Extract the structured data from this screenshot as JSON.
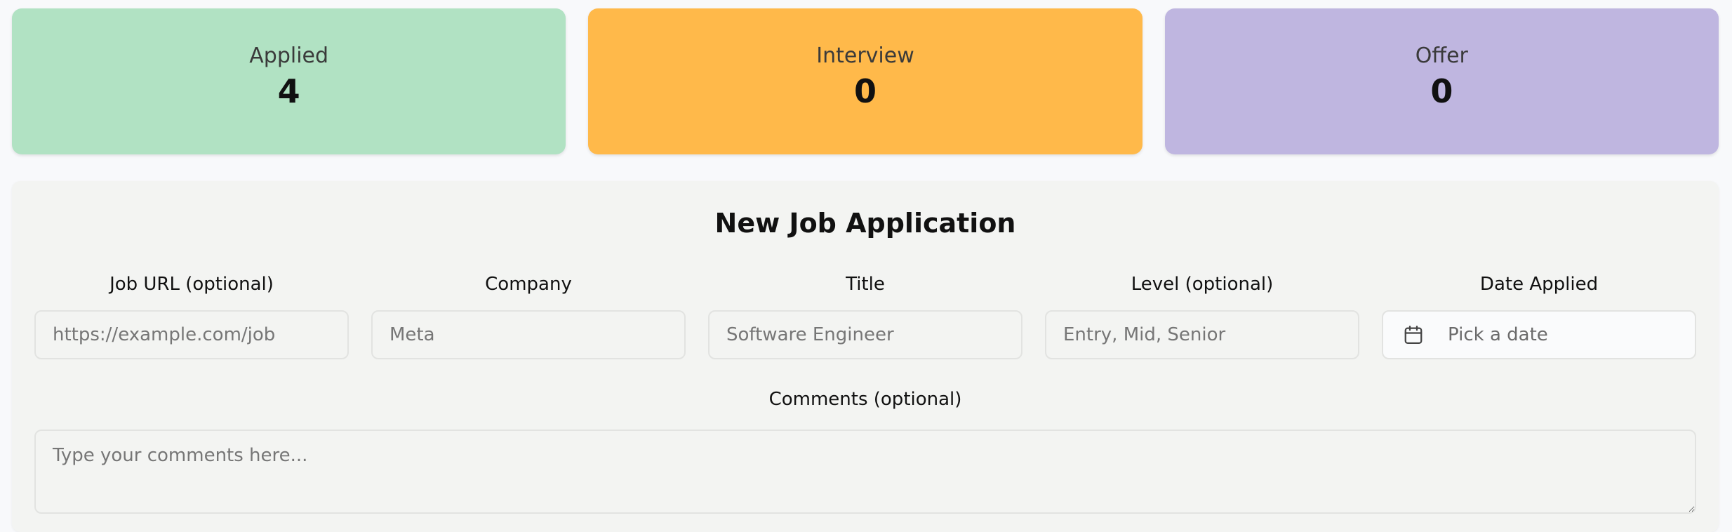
{
  "stats": [
    {
      "label": "Applied",
      "value": "4",
      "color": "#b1e2c3"
    },
    {
      "label": "Interview",
      "value": "0",
      "color": "#ffb94a"
    },
    {
      "label": "Offer",
      "value": "0",
      "color": "#bfb6e0"
    }
  ],
  "form": {
    "title": "New Job Application",
    "fields": {
      "job_url": {
        "label": "Job URL (optional)",
        "placeholder": "https://example.com/job",
        "value": ""
      },
      "company": {
        "label": "Company",
        "placeholder": "Meta",
        "value": ""
      },
      "title": {
        "label": "Title",
        "placeholder": "Software Engineer",
        "value": ""
      },
      "level": {
        "label": "Level (optional)",
        "placeholder": "Entry, Mid, Senior",
        "value": ""
      },
      "date_applied": {
        "label": "Date Applied",
        "placeholder": "Pick a date",
        "icon": "calendar-icon"
      }
    },
    "comments": {
      "label": "Comments (optional)",
      "placeholder": "Type your comments here...",
      "value": ""
    }
  }
}
